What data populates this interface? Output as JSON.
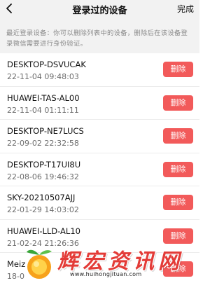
{
  "header": {
    "title": "登录过的设备",
    "done_label": "完成",
    "back_icon": "chevron-left-icon"
  },
  "notice": "最近登录设备：你可以删除列表中的设备，删除后在该设备登录微信需要进行身份验证。",
  "devices": [
    {
      "name": "DESKTOP-DSVUCAK",
      "time": "22-11-04 09:48:03",
      "action": "删除"
    },
    {
      "name": "HUAWEI-TAS-AL00",
      "time": "22-11-04 01:11:11",
      "action": "删除"
    },
    {
      "name": "DESKTOP-NE7LUCS",
      "time": "22-09-02 22:32:58",
      "action": "删除"
    },
    {
      "name": "DESKTOP-T17UI8U",
      "time": "22-08-06 19:46:32",
      "action": "删除"
    },
    {
      "name": "SKY-20210507AJJ",
      "time": "22-01-29 14:03:02",
      "action": "删除"
    },
    {
      "name": "HUAWEI-LLD-AL10",
      "time": "21-02-24 21:26:36",
      "action": "删除"
    },
    {
      "name": "Meiz",
      "time": "18-0",
      "action": "删除"
    }
  ],
  "watermark": {
    "title": "辉宏资讯网",
    "url": "www.huihongjituan.com"
  },
  "colors": {
    "delete_button": "#f25a5a",
    "header_bg": "#f2f2f2",
    "watermark_red": "#e33b37"
  }
}
